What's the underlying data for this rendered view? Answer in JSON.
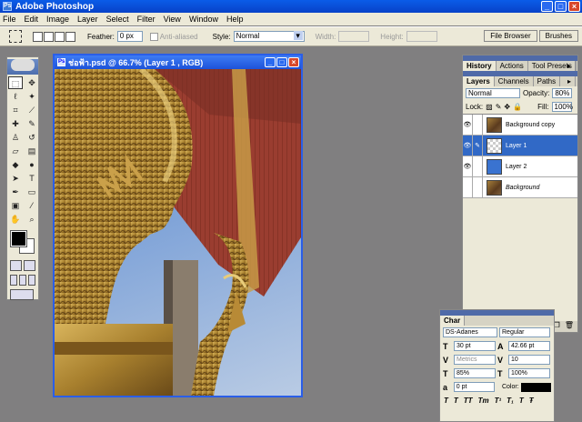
{
  "app": {
    "title": "Adobe Photoshop"
  },
  "menu": [
    "File",
    "Edit",
    "Image",
    "Layer",
    "Select",
    "Filter",
    "View",
    "Window",
    "Help"
  ],
  "options": {
    "feather_label": "Feather:",
    "feather_value": "0 px",
    "antialiased": "Anti-aliased",
    "style_label": "Style:",
    "style_value": "Normal",
    "width_label": "Width:",
    "height_label": "Height:"
  },
  "well": {
    "file_browser": "File Browser",
    "brushes": "Brushes"
  },
  "document": {
    "title": "ช่อฟ้า.psd @ 66.7% (Layer 1 , RGB)",
    "zoom_label": "66.7%"
  },
  "history_panel": {
    "tabs": [
      "History",
      "Actions",
      "Tool Presets"
    ]
  },
  "layers_panel": {
    "tabs": [
      "Layers",
      "Channels",
      "Paths"
    ],
    "blend_mode": "Normal",
    "opacity_label": "Opacity:",
    "opacity_value": "80%",
    "lock_label": "Lock:",
    "fill_label": "Fill:",
    "fill_value": "100%",
    "layers": [
      {
        "name": "Background copy",
        "thumb": "photo",
        "visible": true,
        "selected": false
      },
      {
        "name": "Layer 1",
        "thumb": "transparent",
        "visible": true,
        "selected": true
      },
      {
        "name": "Layer 2",
        "thumb": "blue",
        "visible": true,
        "selected": false
      },
      {
        "name": "Background",
        "thumb": "photo",
        "visible": false,
        "selected": false,
        "italic": true
      }
    ]
  },
  "character_panel": {
    "tab": "Char",
    "font_family": "DS-Adanes",
    "font_style": "Regular",
    "size": "30 pt",
    "leading": "42.66 pt",
    "kerning": "Metrics",
    "tracking": "10",
    "vscale": "85%",
    "hscale": "100%",
    "baseline": "0 pt",
    "color_label": "Color:",
    "color": "#000000"
  },
  "colors": {
    "foreground": "#000000",
    "background": "#ffffff",
    "accent": "#2a5ee8"
  }
}
